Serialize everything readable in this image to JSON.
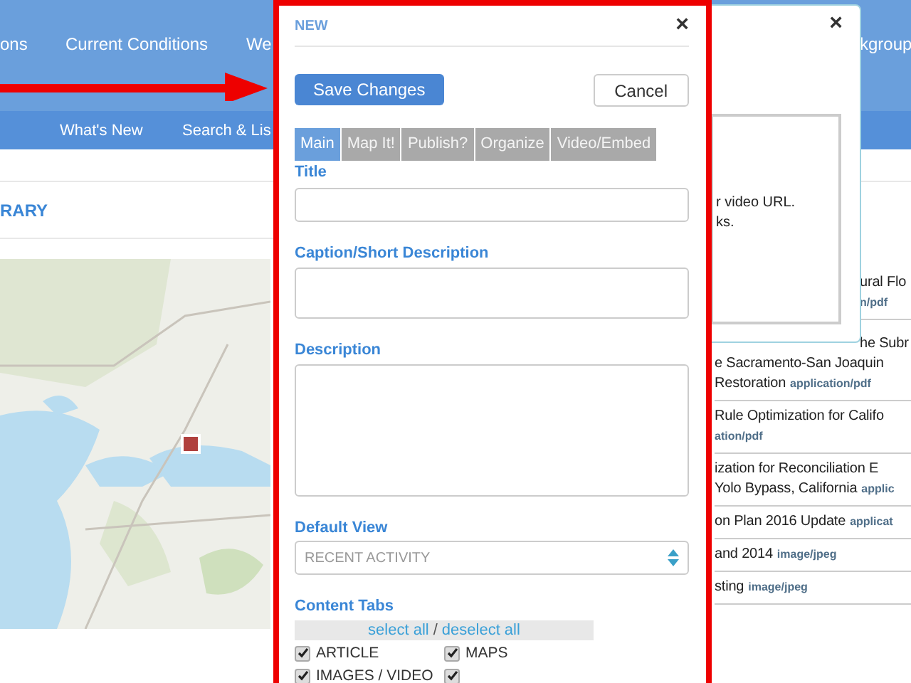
{
  "top_nav": {
    "items": [
      "ons",
      "Current Conditions",
      "We",
      "kgroup"
    ]
  },
  "sub_nav": {
    "items": [
      "What's New",
      "Search & Lis"
    ]
  },
  "section_title": "RARY",
  "documents": [
    {
      "lines": [
        "ural Flo"
      ],
      "type": "n/pdf"
    },
    {
      "lines": [
        "he Subr",
        "e Sacramento-San Joaquin",
        "Restoration"
      ],
      "type": "application/pdf"
    },
    {
      "lines": [
        "Rule Optimization for Califo"
      ],
      "type": "ation/pdf"
    },
    {
      "lines": [
        "ization for Reconciliation E",
        "Yolo Bypass, California"
      ],
      "type": "applic"
    },
    {
      "lines": [
        "on Plan 2016 Update"
      ],
      "type": "applicat"
    },
    {
      "lines": [
        "and 2014"
      ],
      "type": "image/jpeg"
    },
    {
      "lines": [
        "sting"
      ],
      "type": "image/jpeg"
    }
  ],
  "back_dialog": {
    "close": "×",
    "help_lines": [
      "r video URL.",
      "ks."
    ]
  },
  "modal": {
    "title": "NEW",
    "close": "×",
    "buttons": [
      {
        "label": "Save Changes",
        "kind": "primary"
      },
      {
        "label": "Cancel",
        "kind": "default"
      }
    ],
    "tabs": [
      {
        "label": "Main",
        "selected": true
      },
      {
        "label": "Map It!",
        "selected": false
      },
      {
        "label": "Publish?",
        "selected": false
      },
      {
        "label": "Organize",
        "selected": false
      },
      {
        "label": "Video/Embed",
        "selected": false
      }
    ],
    "fields": [
      {
        "label": "Title",
        "kind": "input"
      },
      {
        "label": "Caption/Short Description",
        "kind": "short_textarea"
      },
      {
        "label": "Description",
        "kind": "long_textarea"
      },
      {
        "label": "Default View",
        "kind": "select",
        "value": "RECENT ACTIVITY"
      }
    ],
    "content_tabs": {
      "label": "Content Tabs",
      "select_all": "select all",
      "separator": "/",
      "deselect_all": "deselect all",
      "options": [
        {
          "label": "ARTICLE",
          "checked": true
        },
        {
          "label": "MAPS",
          "checked": true
        },
        {
          "label": "IMAGES / VIDEO",
          "checked": true
        },
        {
          "checked": true
        }
      ]
    }
  }
}
